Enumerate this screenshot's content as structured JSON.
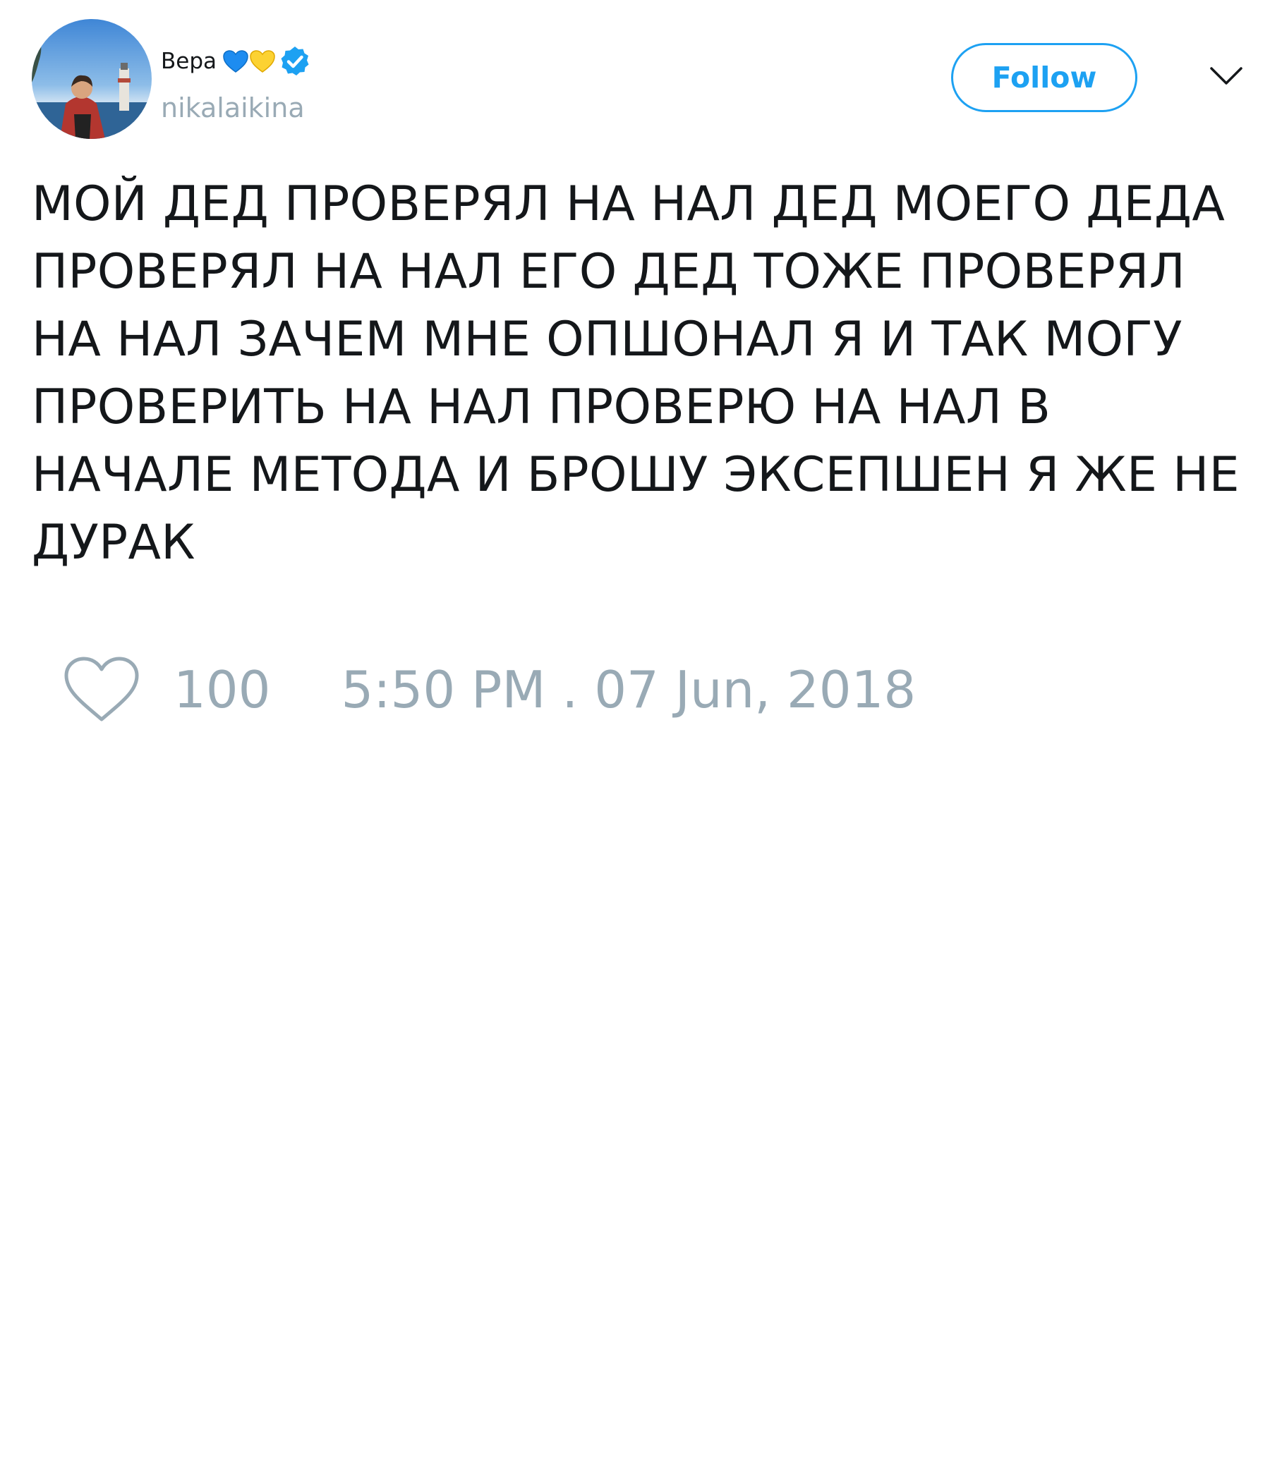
{
  "author": {
    "display_name": "Вера",
    "emojis": [
      "blue-heart",
      "yellow-heart"
    ],
    "verified": true,
    "handle": "nikalaikina"
  },
  "follow_button": {
    "label": "Follow"
  },
  "tweet": {
    "text": "МОЙ ДЕД ПРОВЕРЯЛ НА НАЛ ДЕД МОЕГО ДЕДА ПРОВЕРЯЛ НА НАЛ ЕГО ДЕД ТОЖЕ ПРОВЕРЯЛ НА НАЛ ЗАЧЕМ МНЕ ОПШОНАЛ Я И ТАК МОГУ ПРОВЕРИТЬ НА НАЛ ПРОВЕРЮ НА НАЛ В НАЧАЛЕ МЕТОДА И БРОШУ ЭКСЕПШЕН Я ЖЕ НЕ ДУРАК",
    "like_count": "100",
    "timestamp": "5:50 PM . 07 Jun, 2018"
  },
  "colors": {
    "accent": "#1da1f2",
    "muted": "#99aab5",
    "text": "#14171a"
  }
}
